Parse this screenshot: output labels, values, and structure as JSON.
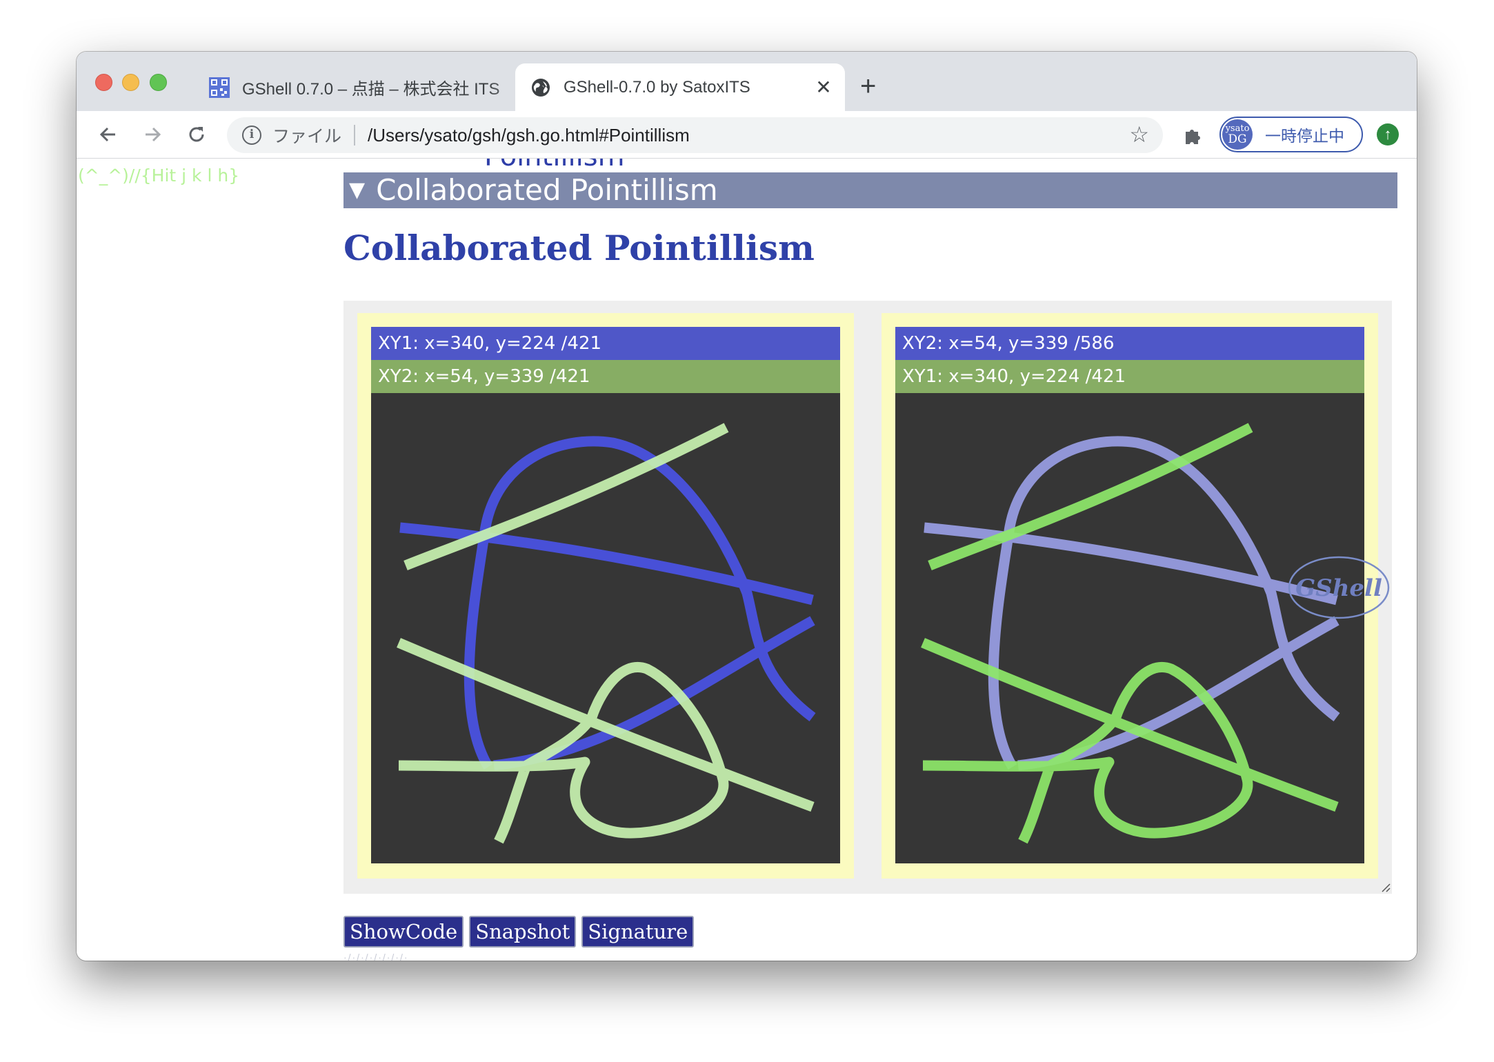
{
  "browser": {
    "tabs": [
      {
        "title": "GShell 0.7.0 – 点描 – 株式会社 ITS",
        "favicon": "qr-code-icon",
        "active": false
      },
      {
        "title": "GShell-0.7.0 by SatoxITS",
        "favicon": "globe-icon",
        "active": true
      }
    ],
    "new_tab_symbol": "+",
    "close_symbol": "✕",
    "address": {
      "scheme_label": "ファイル",
      "url": "/Users/ysato/gsh/gsh.go.html#Pointillism"
    },
    "profile": {
      "avatar_line1": "ysato",
      "avatar_line2": "DG",
      "label": "一時停止中"
    }
  },
  "page": {
    "key_hint": "(^_^)//{Hit j k l h}",
    "prev_section_label": "Pointillism",
    "section_summary": "Collaborated Pointillism",
    "heading": "Collaborated Pointillism",
    "panels": [
      {
        "bar1": "XY1: x=340, y=224 /421",
        "bar2": "XY2: x=54, y=339 /421"
      },
      {
        "bar1": "XY2: x=54, y=339 /586",
        "bar2": "XY1: x=340, y=224 /421"
      }
    ],
    "watermark": "GShell",
    "buttons": [
      "ShowCode",
      "Snapshot",
      "Signature"
    ]
  },
  "colors": {
    "stroke_blue": "#4a52e0",
    "stroke_light_green": "#c8f2b0",
    "stroke_lavender": "#9ea4ee",
    "stroke_bright_green": "#8ee86a",
    "canvas_bg": "#363636",
    "summary_bar": "#7e89ab",
    "heading": "#2f41a8"
  }
}
